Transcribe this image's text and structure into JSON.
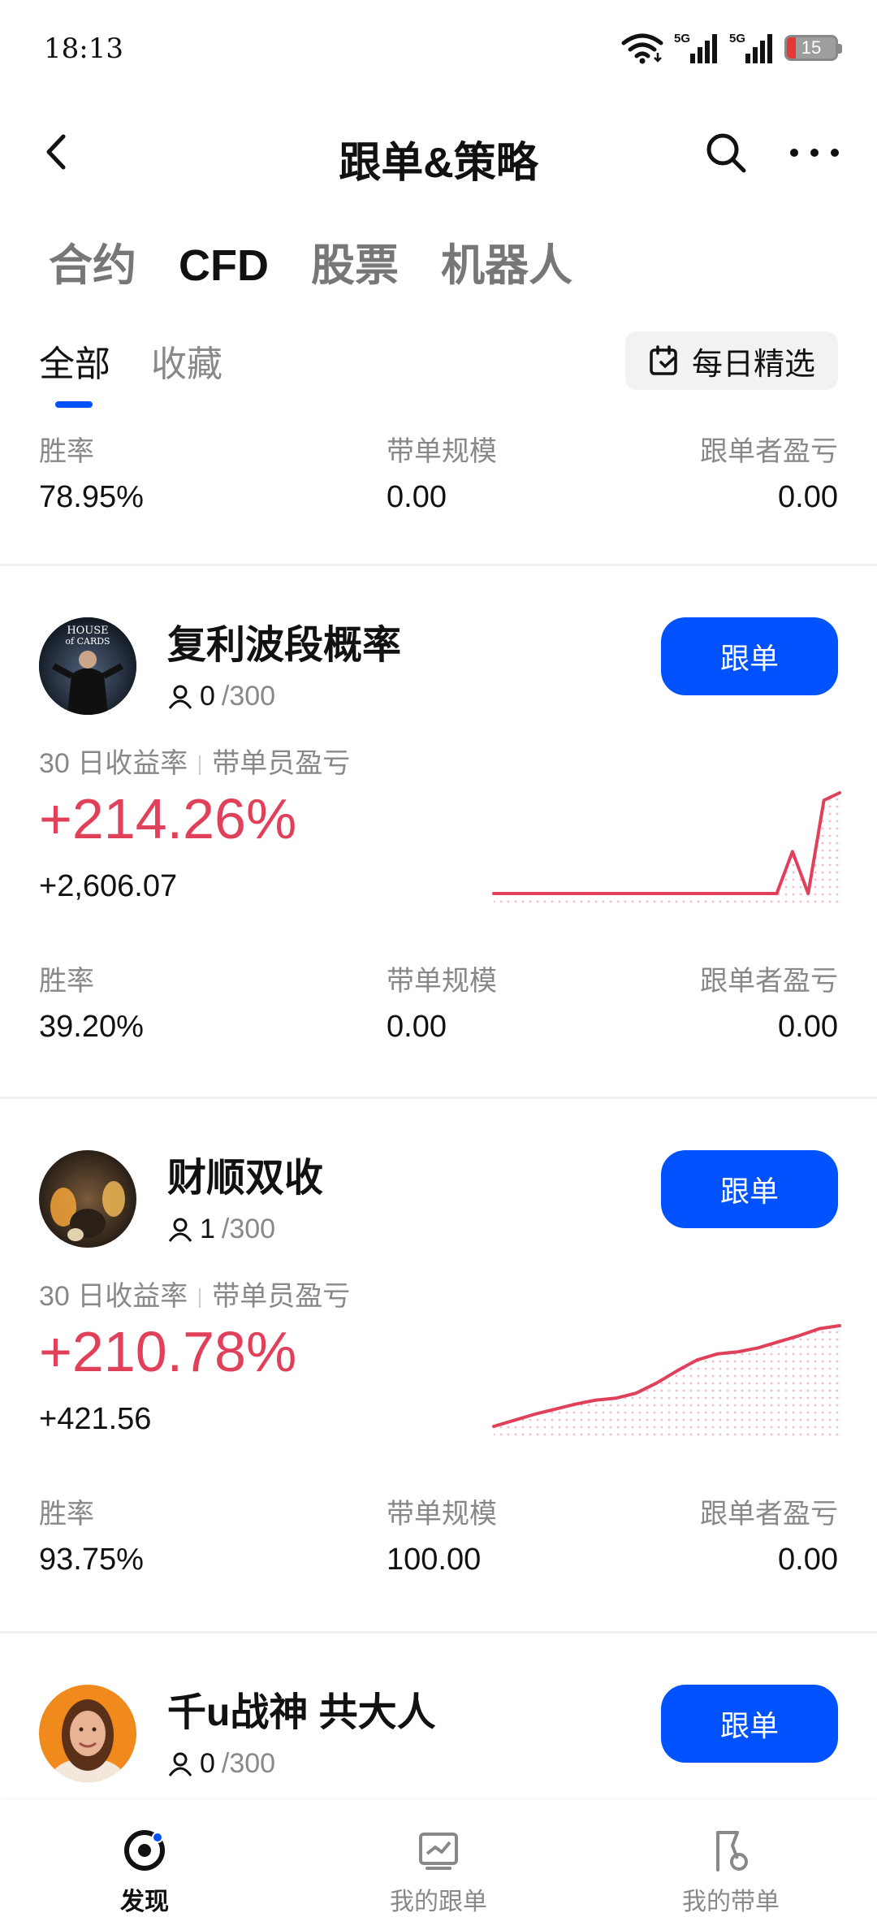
{
  "status_bar": {
    "time": "18:13",
    "battery": "15",
    "network1": "5G",
    "network2": "5G"
  },
  "header": {
    "title": "跟单&策略"
  },
  "category_tabs": [
    "合约",
    "CFD",
    "股票",
    "机器人"
  ],
  "sub_tabs": [
    "全部",
    "收藏"
  ],
  "daily_pick": "每日精选",
  "labels": {
    "win_rate": "胜率",
    "scale": "带单规模",
    "follower_pnl": "跟单者盈亏",
    "return_30d": "30 日收益率",
    "leader_pnl": "带单员盈亏",
    "follow": "跟单"
  },
  "top_stats": {
    "win_rate": "78.95%",
    "scale": "0.00",
    "follower_pnl": "0.00"
  },
  "traders": [
    {
      "name": "复利波段概率",
      "followers_current": "0",
      "followers_max": "/300",
      "return_30d": "+214.26%",
      "leader_pnl": "+2,606.07",
      "win_rate": "39.20%",
      "scale": "0.00",
      "follower_pnl": "0.00",
      "avatar_text": "HOUSE of CARDS",
      "trend": [
        0,
        0,
        0,
        0,
        0,
        0,
        0,
        0,
        0,
        0,
        0,
        0,
        0,
        0,
        0,
        0,
        0,
        0,
        0,
        0.45,
        0,
        1.0,
        1.08
      ]
    },
    {
      "name": "财顺双收",
      "followers_current": "1",
      "followers_max": "/300",
      "return_30d": "+210.78%",
      "leader_pnl": "+421.56",
      "win_rate": "93.75%",
      "scale": "100.00",
      "follower_pnl": "0.00",
      "trend": [
        0,
        0.06,
        0.12,
        0.17,
        0.22,
        0.26,
        0.28,
        0.33,
        0.43,
        0.55,
        0.66,
        0.72,
        0.74,
        0.78,
        0.84,
        0.9,
        0.97,
        1.0
      ]
    },
    {
      "name": "千u战神 共大人",
      "followers_current": "0",
      "followers_max": "/300"
    }
  ],
  "bottom_nav": [
    "发现",
    "我的跟单",
    "我的带单"
  ],
  "colors": {
    "accent": "#0052ff",
    "up": "#e0405a"
  }
}
